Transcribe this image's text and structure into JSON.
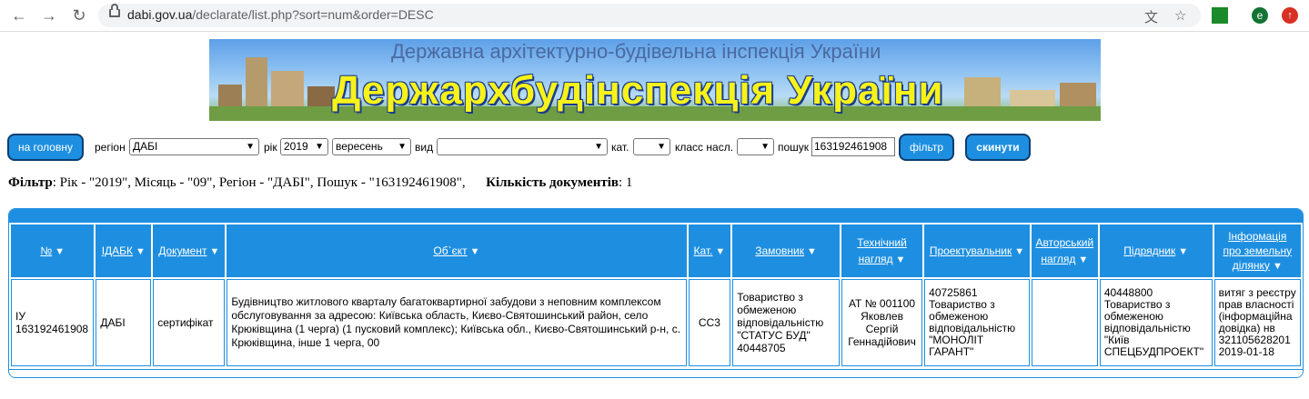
{
  "browser": {
    "url_host": "dabi.gov.ua",
    "url_path": "/declarate/list.php?sort=num&order=DESC",
    "profile_initial": "e"
  },
  "banner": {
    "subtitle": "Державна архітектурно-будівельна інспекція України",
    "title": "Держархбудінспекція України"
  },
  "form": {
    "home_button": "на головну",
    "region_label": "регіон",
    "region_value": "ДАБІ",
    "year_label": "рік",
    "year_value": "2019",
    "month_value": "вересень",
    "type_label": "вид",
    "type_value": "",
    "cat_label": "кат.",
    "cat_value": "",
    "class_label": "класс насл.",
    "class_value": "",
    "search_label": "пошук",
    "search_value": "163192461908",
    "filter_button": "фільтр",
    "reset_button": "скинути"
  },
  "summary": {
    "filter_label": "Фільтр",
    "filter_text": ": Рік - \"2019\", Місяць - \"09\", Регіон - \"ДАБІ\", Пошук - \"163192461908\",",
    "count_label": "Кількість документів",
    "count_value": ": 1"
  },
  "table": {
    "headers": {
      "num": "№",
      "idabk": "ІДАБК",
      "doc": "Документ",
      "object": "Об`єкт",
      "cat": "Кат.",
      "customer": "Замовник",
      "tech_l1": "Технічний",
      "tech_l2": "нагляд",
      "designer": "Проектувальник",
      "author_l1": "Авторський",
      "author_l2": "нагляд",
      "contractor": "Підрядник",
      "land_l1": "Інформація",
      "land_l2": "про земельну",
      "land_l3": "ділянку"
    },
    "row": {
      "num_l1": "ІУ",
      "num_l2": "163192461908",
      "idabk": "ДАБІ",
      "doc": "сертифікат",
      "object": "Будівництво житлового кварталу багатоквартирної забудови з неповним комплексом обслуговування за адресою: Київська область, Києво-Святошинський район, село Крюківщина (1 черга) (1 пусковий комплекс); Київська обл., Києво-Святошинський р-н, с. Крюківщина, інше 1 черга, 00",
      "cat": "СС3",
      "customer_l1": "Товариство з",
      "customer_l2": "обмеженою",
      "customer_l3": "відповідальністю",
      "customer_l4": "\"СТАТУС БУД\"",
      "customer_l5": "40448705",
      "tech_l1": "АТ № 001100",
      "tech_l2": "Яковлев",
      "tech_l3": "Сергій",
      "tech_l4": "Геннадійович",
      "designer_l1": "40725861",
      "designer_l2": "Товариство з",
      "designer_l3": "обмеженою",
      "designer_l4": "відповідальністю",
      "designer_l5": "\"МОНОЛІТ",
      "designer_l6": "ГАРАНТ\"",
      "author": "",
      "contractor_l1": "40448800",
      "contractor_l2": "Товариство з",
      "contractor_l3": "обмеженою",
      "contractor_l4": "відповідальністю",
      "contractor_l5": "\"Київ",
      "contractor_l6": "СПЕЦБУДПРОЕКТ\"",
      "land_l1": "витяг з реєстру",
      "land_l2": "прав власності",
      "land_l3": "(інформаційна",
      "land_l4": "довідка) нв",
      "land_l5": "321105628201",
      "land_l6": "2019-01-18"
    }
  },
  "colors": {
    "accent": "#1e8fe0",
    "banner_title": "#f7f21a"
  }
}
